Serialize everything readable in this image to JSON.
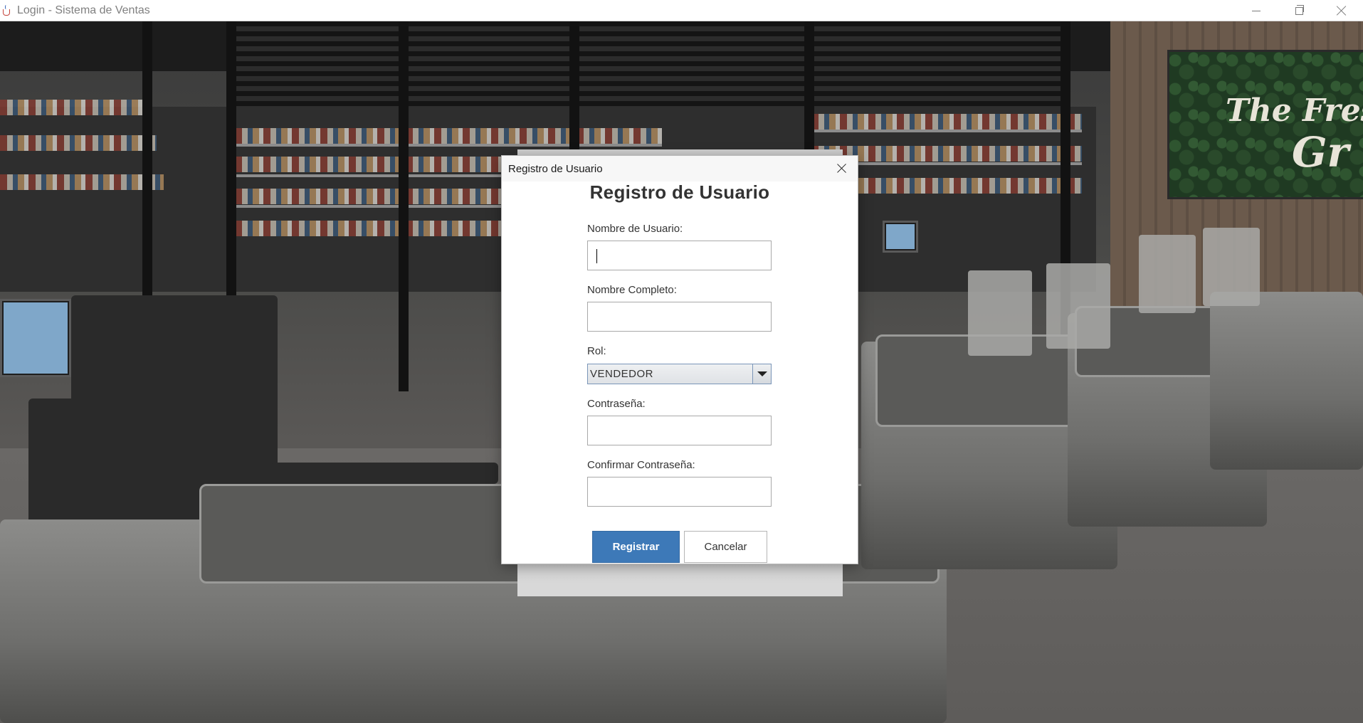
{
  "window": {
    "title": "Login - Sistema de Ventas",
    "icon": "java-cup-icon",
    "controls": [
      "minimize",
      "maximize",
      "close"
    ]
  },
  "background": {
    "sign_line_1": "The Fres",
    "sign_line_2": "Gr"
  },
  "dialog": {
    "title": "Registro de Usuario",
    "heading": "Registro de Usuario",
    "fields": {
      "username": {
        "label": "Nombre de Usuario:",
        "value": ""
      },
      "fullname": {
        "label": "Nombre Completo:",
        "value": ""
      },
      "role": {
        "label": "Rol:",
        "value": "VENDEDOR"
      },
      "password": {
        "label": "Contraseña:",
        "value": ""
      },
      "confirm_password": {
        "label": "Confirmar Contraseña:",
        "value": ""
      }
    },
    "buttons": {
      "register": "Registrar",
      "cancel": "Cancelar"
    }
  },
  "colors": {
    "primary_button": "#3d79b8",
    "heading_text": "#333333"
  }
}
